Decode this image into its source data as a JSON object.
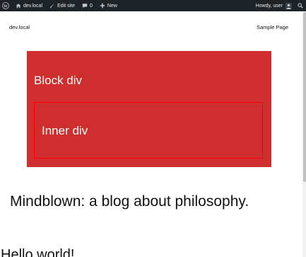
{
  "adminbar": {
    "wp_logo_icon": "wordpress-logo",
    "site_name": "dev.local",
    "edit_site": "Edit site",
    "comments_count": "0",
    "new_label": "New",
    "greeting": "Howdy, user"
  },
  "header": {
    "site_title": "dev.local",
    "nav_link": "Sample Page"
  },
  "content": {
    "block_label": "Block div",
    "inner_label": "Inner div",
    "block_color": "#cf2e2e",
    "inner_border_color": "#ff0000",
    "tagline": "Mindblown: a blog about philosophy.",
    "post_title": "Hello world!"
  }
}
